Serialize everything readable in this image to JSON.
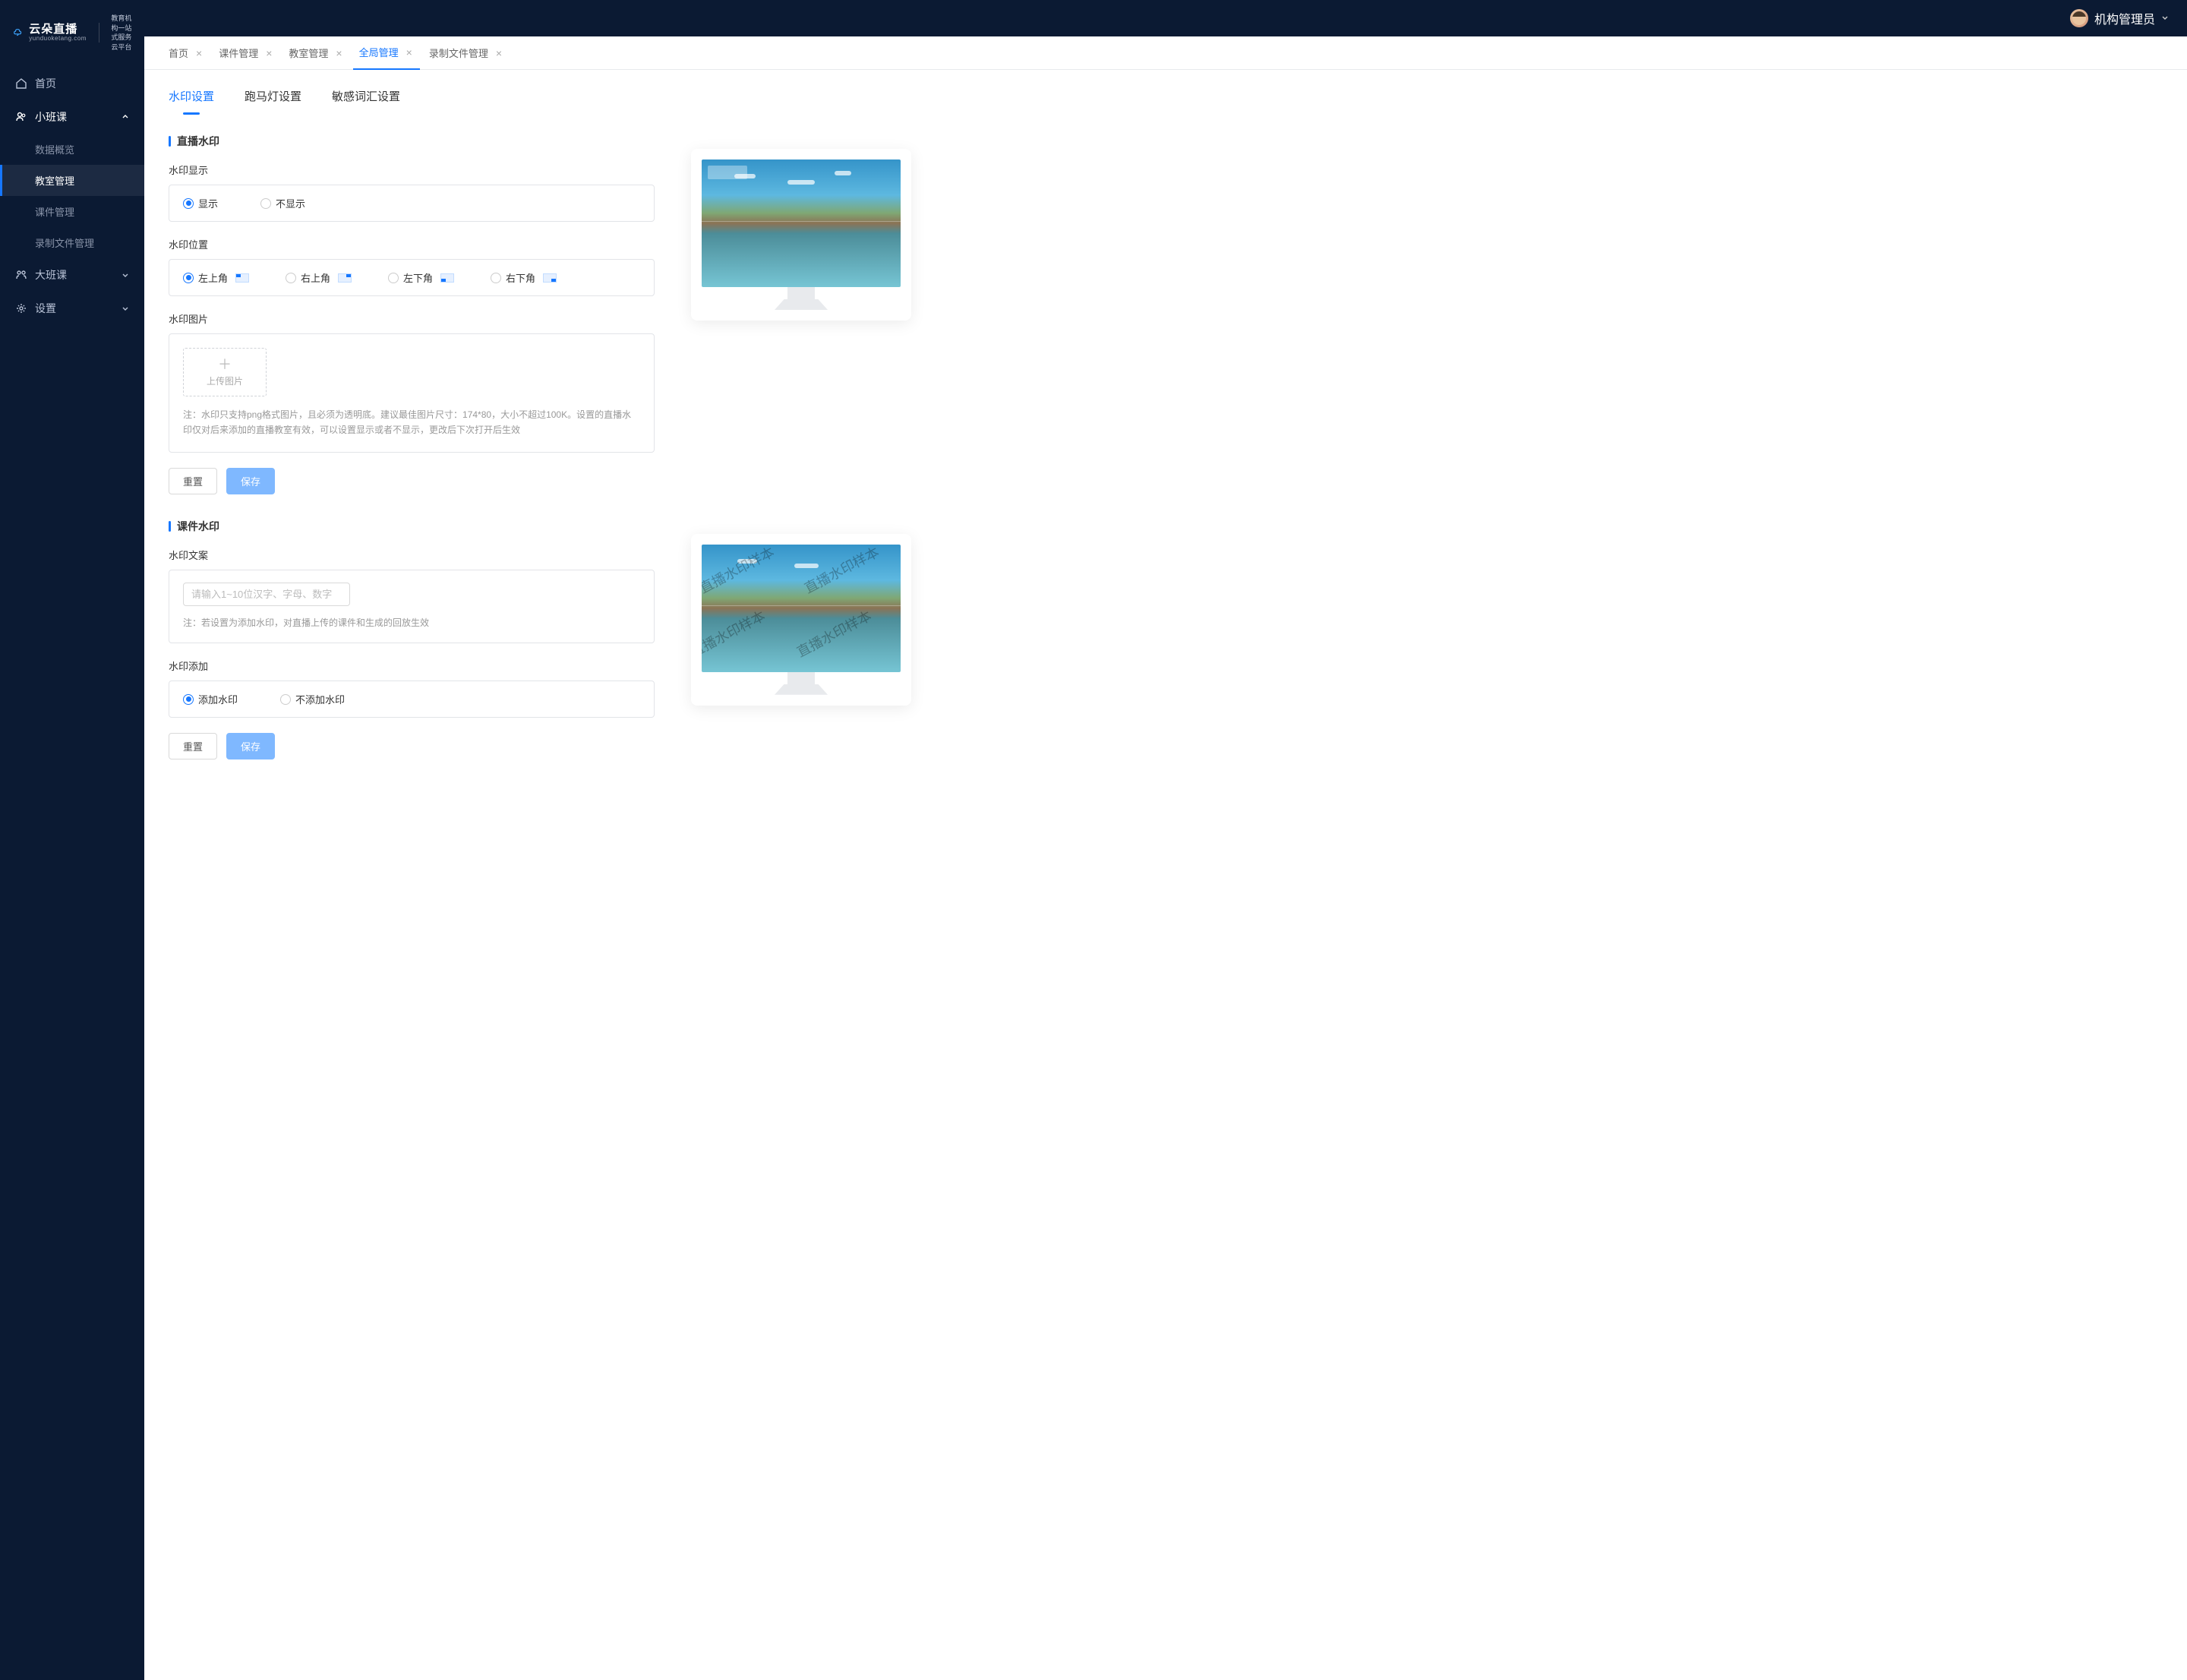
{
  "brand": {
    "title": "云朵直播",
    "subtitle": "yunduoketang.com",
    "slogan_line1": "教育机构一站",
    "slogan_line2": "式服务云平台"
  },
  "topbar": {
    "user_name": "机构管理员"
  },
  "sidebar": {
    "items": [
      {
        "label": "首页",
        "icon": "home"
      },
      {
        "label": "小班课",
        "icon": "users",
        "children": [
          {
            "label": "数据概览"
          },
          {
            "label": "教室管理",
            "active": true
          },
          {
            "label": "课件管理"
          },
          {
            "label": "录制文件管理"
          }
        ]
      },
      {
        "label": "大班课",
        "icon": "group"
      },
      {
        "label": "设置",
        "icon": "gear"
      }
    ]
  },
  "open_tabs": [
    {
      "label": "首页"
    },
    {
      "label": "课件管理"
    },
    {
      "label": "教室管理"
    },
    {
      "label": "全局管理",
      "active": true
    },
    {
      "label": "录制文件管理"
    }
  ],
  "sub_tabs": [
    {
      "label": "水印设置",
      "active": true
    },
    {
      "label": "跑马灯设置"
    },
    {
      "label": "敏感词汇设置"
    }
  ],
  "section_live": {
    "title": "直播水印",
    "display_label": "水印显示",
    "display_options": {
      "show": "显示",
      "hide": "不显示"
    },
    "position_label": "水印位置",
    "position_options": {
      "tl": "左上角",
      "tr": "右上角",
      "bl": "左下角",
      "br": "右下角"
    },
    "image_label": "水印图片",
    "upload_label": "上传图片",
    "note": "注：水印只支持png格式图片，且必须为透明底。建议最佳图片尺寸：174*80，大小不超过100K。设置的直播水印仅对后来添加的直播教室有效，可以设置显示或者不显示，更改后下次打开后生效",
    "btn_reset": "重置",
    "btn_save": "保存"
  },
  "section_courseware": {
    "title": "课件水印",
    "text_label": "水印文案",
    "placeholder": "请输入1~10位汉字、字母、数字",
    "note": "注：若设置为添加水印，对直播上传的课件和生成的回放生效",
    "add_label": "水印添加",
    "add_options": {
      "yes": "添加水印",
      "no": "不添加水印"
    },
    "btn_reset": "重置",
    "btn_save": "保存",
    "sample_text": "直播水印样本"
  }
}
